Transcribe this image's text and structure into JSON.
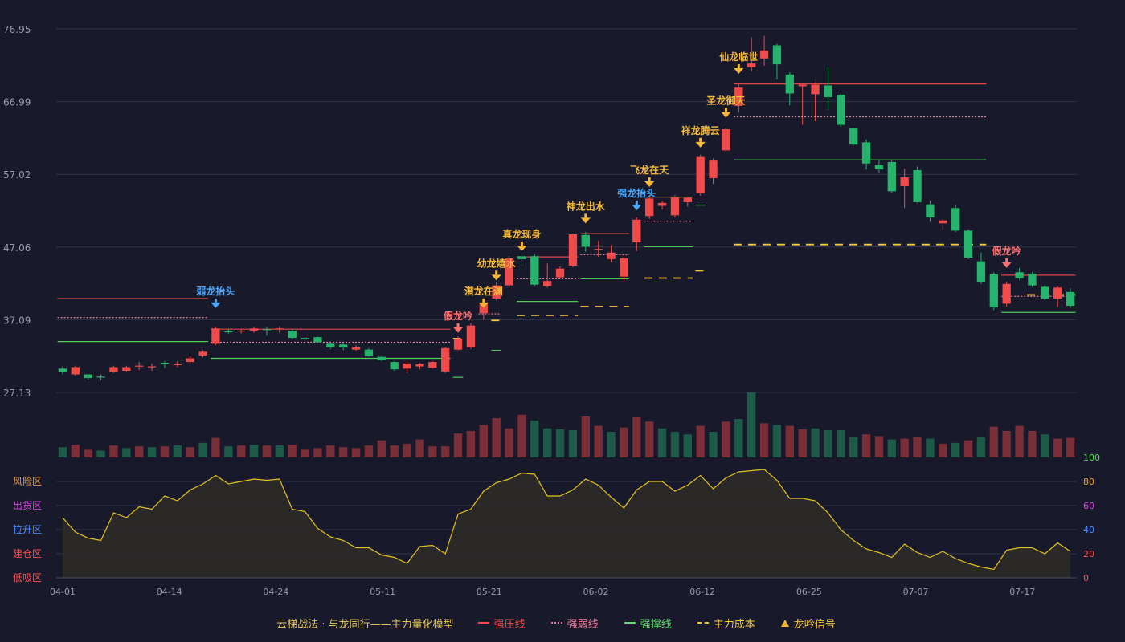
{
  "chart_data": {
    "type": "candlestick",
    "x_ticks": [
      "04-01",
      "04-14",
      "04-24",
      "05-11",
      "05-21",
      "06-02",
      "06-12",
      "06-25",
      "07-07",
      "07-17"
    ],
    "y_ticks": [
      "76.95",
      "66.99",
      "57.02",
      "47.06",
      "37.09",
      "27.13"
    ],
    "ylim": [
      27.13,
      76.95
    ],
    "candles": [
      [
        30.4,
        29.9,
        30.7,
        29.6
      ],
      [
        29.6,
        30.6,
        30.8,
        29.4
      ],
      [
        29.6,
        29.1,
        29.7,
        28.9
      ],
      [
        29.3,
        29.2,
        29.6,
        28.8
      ],
      [
        29.9,
        30.6,
        30.8,
        29.8
      ],
      [
        30.1,
        30.6,
        30.8,
        29.9
      ],
      [
        30.8,
        30.8,
        31.3,
        30.2
      ],
      [
        30.6,
        30.7,
        31.1,
        30.1
      ],
      [
        31.2,
        31.0,
        31.4,
        30.5
      ],
      [
        31.0,
        31.0,
        31.4,
        30.6
      ],
      [
        31.3,
        31.8,
        32.1,
        31.1
      ],
      [
        32.2,
        32.7,
        32.9,
        32.0
      ],
      [
        33.8,
        35.9,
        36.1,
        33.6
      ],
      [
        35.5,
        35.4,
        35.8,
        35.2
      ],
      [
        35.5,
        35.6,
        35.8,
        35.2
      ],
      [
        35.6,
        35.9,
        36.1,
        35.3
      ],
      [
        35.8,
        35.7,
        36.1,
        34.9
      ],
      [
        35.9,
        35.9,
        36.2,
        35.3
      ],
      [
        35.6,
        34.6,
        35.8,
        34.4
      ],
      [
        34.6,
        34.4,
        34.7,
        34.2
      ],
      [
        34.7,
        34.0,
        34.8,
        33.9
      ],
      [
        33.8,
        33.3,
        34.1,
        33.1
      ],
      [
        33.7,
        33.3,
        33.8,
        32.9
      ],
      [
        33.0,
        33.3,
        33.6,
        32.8
      ],
      [
        33.0,
        32.1,
        33.2,
        32.0
      ],
      [
        32.0,
        31.6,
        32.1,
        31.4
      ],
      [
        31.3,
        30.3,
        31.4,
        30.1
      ],
      [
        30.4,
        31.1,
        31.4,
        29.8
      ],
      [
        30.7,
        31.0,
        31.2,
        30.3
      ],
      [
        30.5,
        31.3,
        31.4,
        30.4
      ],
      [
        30.0,
        33.2,
        33.4,
        29.8
      ],
      [
        33.0,
        34.5,
        34.8,
        32.9
      ],
      [
        33.3,
        36.3,
        36.6,
        33.1
      ],
      [
        38.0,
        39.4,
        39.7,
        37.1
      ],
      [
        40.0,
        41.8,
        42.2,
        39.8
      ],
      [
        41.8,
        45.5,
        45.8,
        41.5
      ],
      [
        45.8,
        45.4,
        45.9,
        44.4
      ],
      [
        45.8,
        41.9,
        46.1,
        41.7
      ],
      [
        41.7,
        42.4,
        44.8,
        41.5
      ],
      [
        42.9,
        44.1,
        44.4,
        42.7
      ],
      [
        44.5,
        48.8,
        48.9,
        44.3
      ],
      [
        48.7,
        47.1,
        49.1,
        46.4
      ],
      [
        46.8,
        46.8,
        47.9,
        45.7
      ],
      [
        45.4,
        46.3,
        47.3,
        45.0
      ],
      [
        43.0,
        45.5,
        45.8,
        42.4
      ],
      [
        47.7,
        50.8,
        51.1,
        46.5
      ],
      [
        51.3,
        53.7,
        53.9,
        50.9
      ],
      [
        52.7,
        53.1,
        53.4,
        52.2
      ],
      [
        51.4,
        53.9,
        54.2,
        51.1
      ],
      [
        53.2,
        53.8,
        53.9,
        52.6
      ],
      [
        54.4,
        59.4,
        59.7,
        54.1
      ],
      [
        56.5,
        58.9,
        59.2,
        55.7
      ],
      [
        60.3,
        63.2,
        63.4,
        60.1
      ],
      [
        66.4,
        68.9,
        69.4,
        65.5
      ],
      [
        71.7,
        72.2,
        75.8,
        71.1
      ],
      [
        72.9,
        74.0,
        76.0,
        71.9
      ],
      [
        74.7,
        72.1,
        74.9,
        70.0
      ],
      [
        70.7,
        68.1,
        71.0,
        66.5
      ],
      [
        69.1,
        69.3,
        69.4,
        63.8
      ],
      [
        68.0,
        69.3,
        69.6,
        64.3
      ],
      [
        69.2,
        67.6,
        71.7,
        65.9
      ],
      [
        67.9,
        63.8,
        68.1,
        63.5
      ],
      [
        63.3,
        61.1,
        63.4,
        61.0
      ],
      [
        61.4,
        58.5,
        61.8,
        57.7
      ],
      [
        58.3,
        57.7,
        58.9,
        57.2
      ],
      [
        58.7,
        54.7,
        59.0,
        54.5
      ],
      [
        55.4,
        56.6,
        57.8,
        52.4
      ],
      [
        57.6,
        53.2,
        58.1,
        53.1
      ],
      [
        52.9,
        51.1,
        53.4,
        50.5
      ],
      [
        50.3,
        50.7,
        51.0,
        49.3
      ],
      [
        52.4,
        49.3,
        52.8,
        49.1
      ],
      [
        49.3,
        45.6,
        49.5,
        45.4
      ],
      [
        45.1,
        42.2,
        46.3,
        42.0
      ],
      [
        43.3,
        38.8,
        43.6,
        38.4
      ],
      [
        39.3,
        42.0,
        42.3,
        38.9
      ],
      [
        43.6,
        42.8,
        44.2,
        42.6
      ],
      [
        43.4,
        41.8,
        43.6,
        41.6
      ],
      [
        41.6,
        40.0,
        41.8,
        39.8
      ],
      [
        40.0,
        41.5,
        41.7,
        38.9
      ],
      [
        40.9,
        39.0,
        41.4,
        38.7
      ]
    ],
    "volume": [
      12,
      15,
      9,
      8,
      14,
      11,
      13,
      12,
      13,
      14,
      12,
      17,
      23,
      13,
      14,
      15,
      14,
      14,
      15,
      9,
      11,
      14,
      12,
      11,
      14,
      20,
      14,
      16,
      21,
      13,
      13,
      28,
      31,
      38,
      46,
      34,
      50,
      43,
      34,
      33,
      32,
      48,
      37,
      30,
      35,
      47,
      42,
      34,
      30,
      27,
      37,
      30,
      42,
      45,
      76,
      40,
      38,
      37,
      33,
      34,
      32,
      32,
      24,
      27,
      25,
      21,
      22,
      24,
      22,
      16,
      17,
      20,
      24,
      36,
      31,
      37,
      31,
      27,
      22,
      23
    ],
    "volume_up": [
      false,
      true,
      true,
      false,
      true,
      false,
      true,
      false,
      true,
      false,
      true,
      false,
      true,
      false,
      true,
      false,
      true,
      false,
      true,
      true,
      true,
      true,
      true,
      true,
      true,
      true,
      true,
      true,
      true,
      true,
      true,
      true,
      true,
      true,
      true,
      true,
      true,
      false,
      false,
      false,
      false,
      true,
      true,
      false,
      true,
      true,
      true,
      false,
      false,
      false,
      true,
      false,
      true,
      false,
      false,
      true,
      false,
      true,
      true,
      false,
      false,
      false,
      false,
      true,
      true,
      false,
      true,
      true,
      false,
      true,
      false,
      true,
      false,
      true,
      true,
      true,
      true,
      false,
      true,
      true
    ],
    "up_colors_by_close": true,
    "indicator": [
      50,
      38,
      33,
      31,
      54,
      50,
      59,
      57,
      68,
      64,
      73,
      78,
      85,
      78,
      80,
      82,
      81,
      82,
      57,
      55,
      41,
      34,
      31,
      25,
      25,
      19,
      17,
      12,
      26,
      27,
      20,
      53,
      57,
      72,
      79,
      82,
      87,
      86,
      68,
      68,
      73,
      82,
      77,
      67,
      58,
      73,
      80,
      80,
      72,
      77,
      85,
      74,
      83,
      88,
      89,
      90,
      81,
      66,
      66,
      64,
      54,
      40,
      31,
      24,
      21,
      17,
      28,
      21,
      17,
      22,
      16,
      12,
      9,
      7,
      23,
      25,
      25,
      20,
      29,
      22
    ],
    "indicator_yticks": [
      "100",
      "80",
      "60",
      "40",
      "20",
      "0"
    ],
    "zones": [
      "风险区",
      "出货区",
      "拉升区",
      "建仓区",
      "低吸区"
    ],
    "signals": [
      {
        "i": 12,
        "label": "弱龙抬头",
        "kind": "blue",
        "y": 38.8
      },
      {
        "i": 31,
        "label": "假龙吟",
        "kind": "red",
        "y": 35.4
      },
      {
        "i": 33,
        "label": "潜龙在渊",
        "kind": "gold",
        "y": 38.8
      },
      {
        "i": 34,
        "label": "幼龙嬉水",
        "kind": "gold",
        "y": 42.6
      },
      {
        "i": 36,
        "label": "真龙现身",
        "kind": "gold",
        "y": 46.6
      },
      {
        "i": 41,
        "label": "神龙出水",
        "kind": "gold",
        "y": 50.4
      },
      {
        "i": 45,
        "label": "强龙抬头",
        "kind": "blue",
        "y": 52.2
      },
      {
        "i": 46,
        "label": "飞龙在天",
        "kind": "gold",
        "y": 55.4
      },
      {
        "i": 50,
        "label": "祥龙腾云",
        "kind": "gold",
        "y": 60.8
      },
      {
        "i": 52,
        "label": "圣龙御天",
        "kind": "gold",
        "y": 64.9
      },
      {
        "i": 53,
        "label": "仙龙临世",
        "kind": "gold",
        "y": 70.9
      },
      {
        "i": 74,
        "label": "假龙吟",
        "kind": "red",
        "y": 44.3
      }
    ],
    "levels": [
      {
        "type": "press",
        "y": 40.0,
        "i0": 0,
        "i1": 11
      },
      {
        "type": "weak",
        "y": 37.4,
        "i0": 0,
        "i1": 11
      },
      {
        "type": "support",
        "y": 34.1,
        "i0": 0,
        "i1": 11
      },
      {
        "type": "press",
        "y": 35.8,
        "i0": 12,
        "i1": 30
      },
      {
        "type": "weak",
        "y": 34.0,
        "i0": 12,
        "i1": 30
      },
      {
        "type": "support",
        "y": 31.8,
        "i0": 12,
        "i1": 30
      },
      {
        "type": "cost",
        "y": 34.5,
        "i0": 31,
        "i1": 31
      },
      {
        "type": "support",
        "y": 29.2,
        "i0": 31,
        "i1": 31
      },
      {
        "type": "cost",
        "y": 37.0,
        "i0": 34,
        "i1": 34
      },
      {
        "type": "weak",
        "y": 37.9,
        "i0": 33,
        "i1": 34
      },
      {
        "type": "support",
        "y": 32.9,
        "i0": 34,
        "i1": 34
      },
      {
        "type": "press",
        "y": 45.7,
        "i0": 36,
        "i1": 40
      },
      {
        "type": "weak",
        "y": 42.7,
        "i0": 36,
        "i1": 40
      },
      {
        "type": "support",
        "y": 39.6,
        "i0": 36,
        "i1": 40
      },
      {
        "type": "cost",
        "y": 37.7,
        "i0": 36,
        "i1": 40
      },
      {
        "type": "press",
        "y": 48.9,
        "i0": 41,
        "i1": 44
      },
      {
        "type": "weak",
        "y": 46.0,
        "i0": 41,
        "i1": 44
      },
      {
        "type": "support",
        "y": 42.7,
        "i0": 41,
        "i1": 44
      },
      {
        "type": "cost",
        "y": 38.9,
        "i0": 41,
        "i1": 44
      },
      {
        "type": "press",
        "y": 53.9,
        "i0": 46,
        "i1": 49
      },
      {
        "type": "weak",
        "y": 50.6,
        "i0": 46,
        "i1": 49
      },
      {
        "type": "support",
        "y": 47.1,
        "i0": 46,
        "i1": 49
      },
      {
        "type": "cost",
        "y": 42.8,
        "i0": 46,
        "i1": 49
      },
      {
        "type": "support",
        "y": 52.8,
        "i0": 50,
        "i1": 50
      },
      {
        "type": "cost",
        "y": 43.8,
        "i0": 50,
        "i1": 50
      },
      {
        "type": "press",
        "y": 69.4,
        "i0": 53,
        "i1": 72
      },
      {
        "type": "weak",
        "y": 64.9,
        "i0": 53,
        "i1": 72
      },
      {
        "type": "support",
        "y": 59.0,
        "i0": 53,
        "i1": 72
      },
      {
        "type": "cost",
        "y": 47.4,
        "i0": 53,
        "i1": 72
      },
      {
        "type": "press",
        "y": 43.2,
        "i0": 74,
        "i1": 79
      },
      {
        "type": "weak",
        "y": 40.3,
        "i0": 74,
        "i1": 79
      },
      {
        "type": "support",
        "y": 38.1,
        "i0": 74,
        "i1": 79
      },
      {
        "type": "cost",
        "y": 40.5,
        "i0": 76,
        "i1": 79
      }
    ]
  },
  "legend": {
    "title": "云梯战法 · 与龙同行——主力量化模型",
    "items": [
      {
        "label": "强压线",
        "color": "#f24b4b",
        "style": "solid"
      },
      {
        "label": "强弱线",
        "color": "#f57a9a",
        "style": "dotted"
      },
      {
        "label": "强撑线",
        "color": "#5de06a",
        "style": "solid"
      },
      {
        "label": "主力成本",
        "color": "#f5c93a",
        "style": "dashed"
      },
      {
        "label": "龙吟信号",
        "color": "#f5b939",
        "style": "triangle"
      }
    ]
  },
  "colors": {
    "up": "#ef4b4b",
    "down": "#26b36b",
    "grid": "#32354a",
    "axis": "#9a9cab",
    "press": "#e04848",
    "weak": "#f07a9a",
    "support": "#4fcb5a",
    "cost": "#f5c93a",
    "gold": "#f5b939",
    "blue": "#4aa8ff",
    "red": "#ff6f6f",
    "vol_up": "#7a2e38",
    "vol_down": "#1e5a48",
    "ind_line": "#e6c21e",
    "ind_fill": "#2e2a28"
  }
}
